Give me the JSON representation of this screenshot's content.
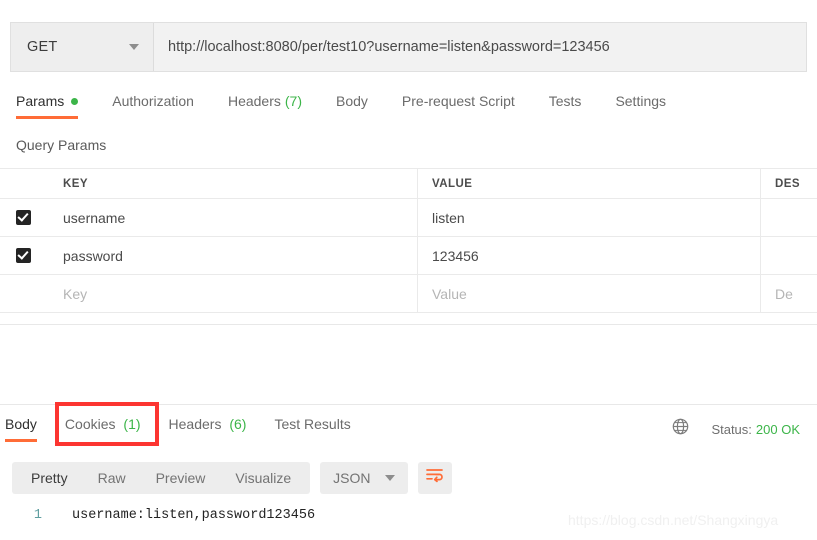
{
  "request": {
    "method": "GET",
    "url": "http://localhost:8080/per/test10?username=listen&password=123456",
    "tabs": [
      {
        "label": "Params",
        "badge": "dot",
        "active": true
      },
      {
        "label": "Authorization",
        "badge": "",
        "active": false
      },
      {
        "label": "Headers",
        "badge": "(7)",
        "active": false
      },
      {
        "label": "Body",
        "badge": "",
        "active": false
      },
      {
        "label": "Pre-request Script",
        "badge": "",
        "active": false
      },
      {
        "label": "Tests",
        "badge": "",
        "active": false
      },
      {
        "label": "Settings",
        "badge": "",
        "active": false
      }
    ],
    "section_title": "Query Params",
    "table": {
      "headers": {
        "key": "KEY",
        "value": "VALUE",
        "description": "DES"
      },
      "rows": [
        {
          "checked": true,
          "key": "username",
          "value": "listen",
          "description": ""
        },
        {
          "checked": true,
          "key": "password",
          "value": "123456",
          "description": ""
        }
      ],
      "placeholder_row": {
        "key": "Key",
        "value": "Value",
        "description": "De"
      }
    }
  },
  "response": {
    "tabs": [
      {
        "label": "Body",
        "badge": "",
        "active": true
      },
      {
        "label": "Cookies",
        "badge": "(1)",
        "active": false
      },
      {
        "label": "Headers",
        "badge": "(6)",
        "active": false
      },
      {
        "label": "Test Results",
        "badge": "",
        "active": false
      }
    ],
    "status_label": "Status:",
    "status_value": "200 OK",
    "view_modes": [
      {
        "label": "Pretty",
        "active": true
      },
      {
        "label": "Raw",
        "active": false
      },
      {
        "label": "Preview",
        "active": false
      },
      {
        "label": "Visualize",
        "active": false
      }
    ],
    "format": "JSON",
    "body_lines": [
      {
        "number": "1",
        "text": "username:listen,password123456"
      }
    ]
  },
  "watermark": "https://blog.csdn.net/Shangxingya",
  "colors": {
    "accent_orange": "#ff6c37",
    "success_green": "#3cb549",
    "annotation_red": "#fc3531"
  }
}
